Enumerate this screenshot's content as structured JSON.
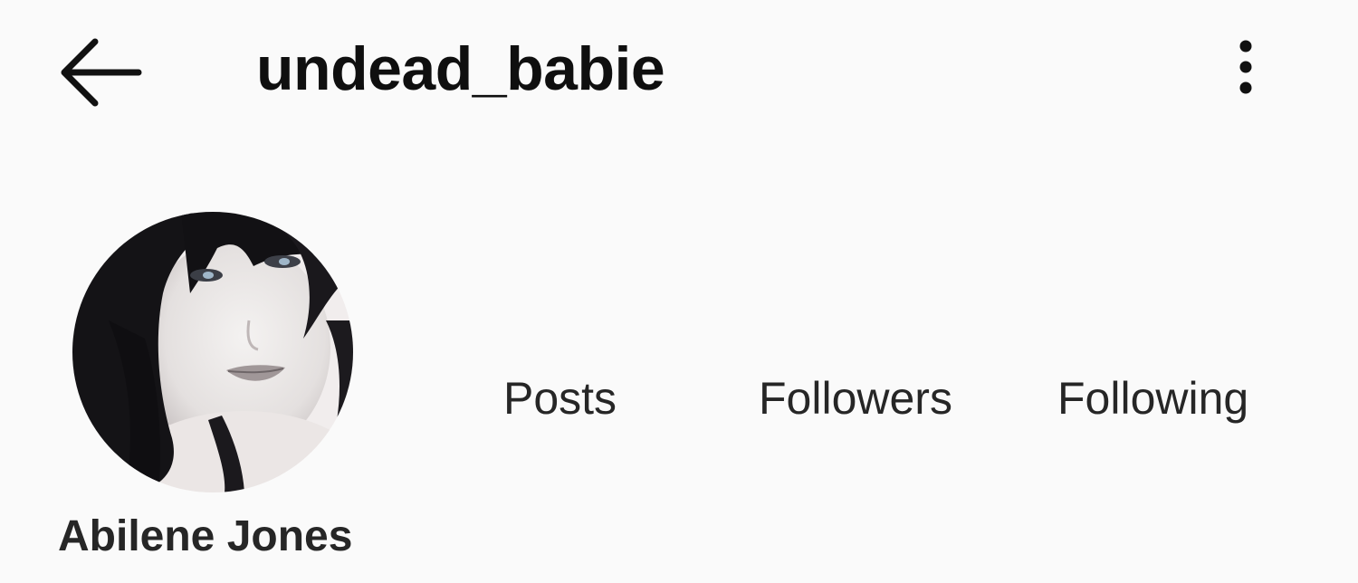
{
  "header": {
    "back_icon": "arrow-left-icon",
    "username": "undead_babie",
    "more_icon": "more-vertical-icon"
  },
  "profile": {
    "avatar_icon": "profile-photo",
    "display_name": "Abilene Jones",
    "stats": {
      "posts_label": "Posts",
      "followers_label": "Followers",
      "following_label": "Following"
    }
  },
  "colors": {
    "background": "#fafafa",
    "text_primary": "#111111",
    "text_secondary": "#262626"
  }
}
